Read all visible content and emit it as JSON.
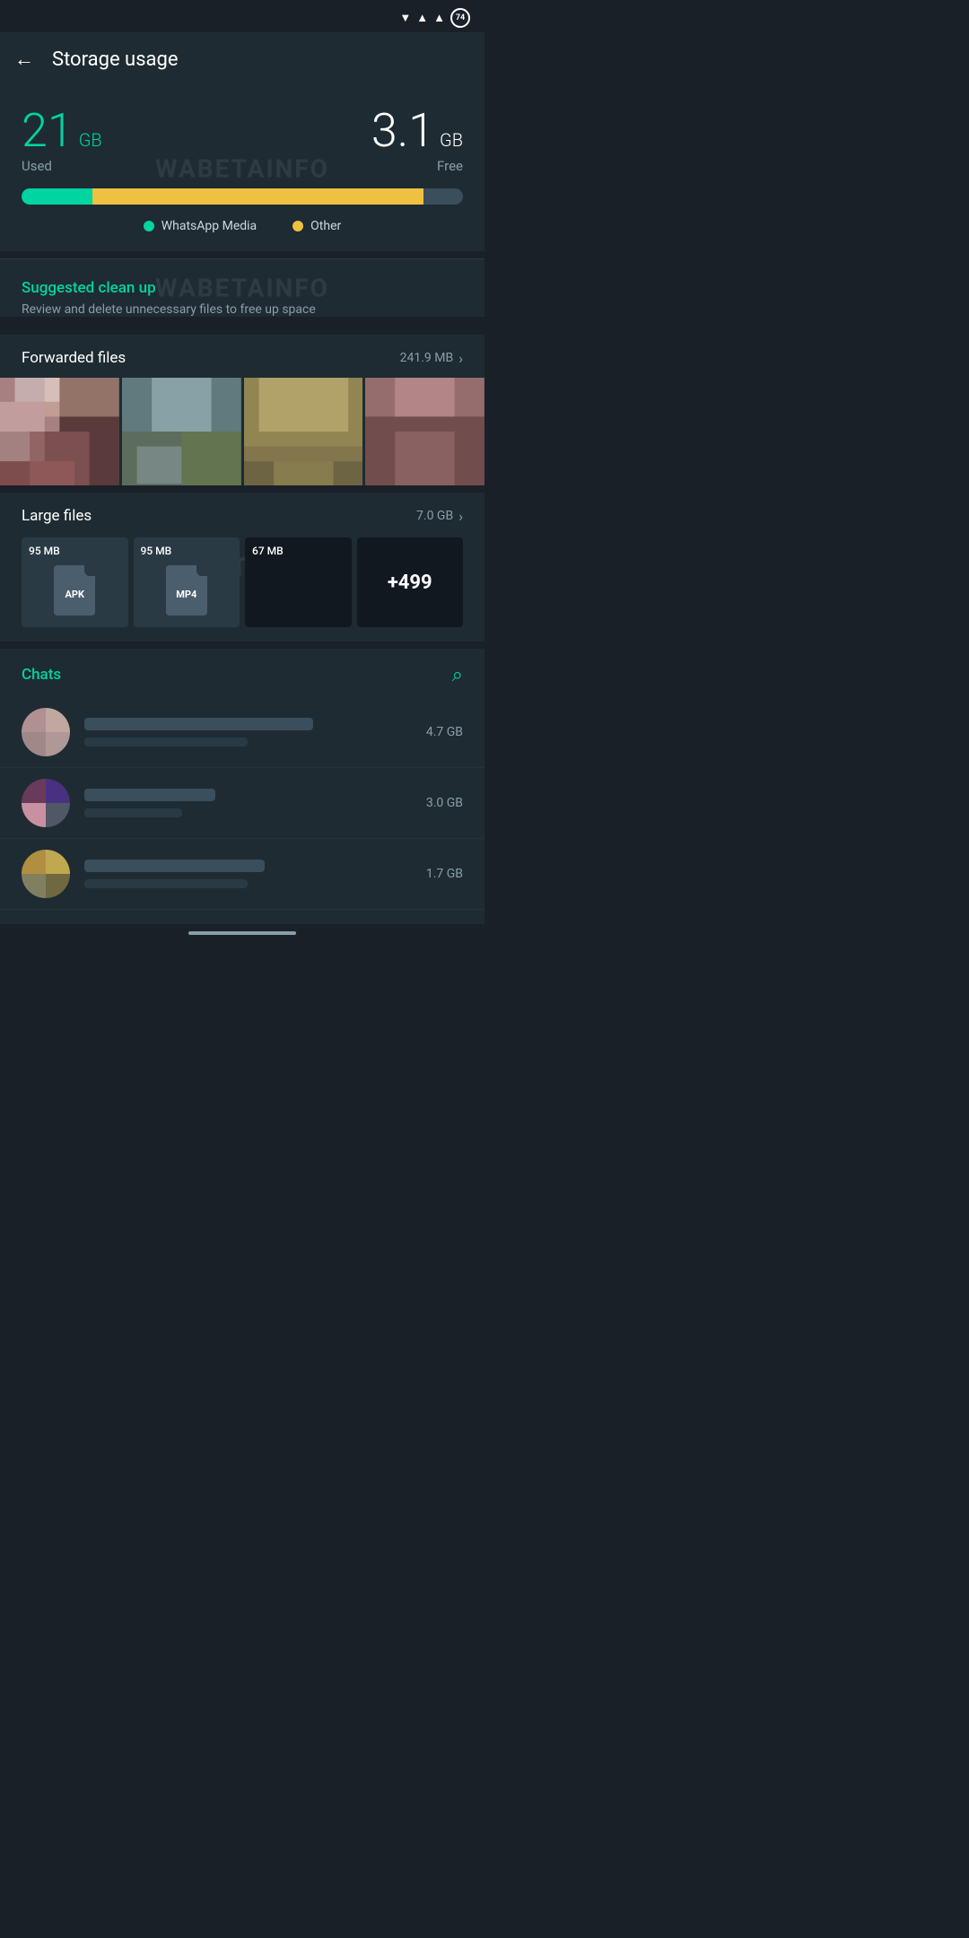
{
  "statusBar": {
    "battery": "74"
  },
  "toolbar": {
    "title": "Storage usage",
    "backLabel": "←"
  },
  "storage": {
    "usedNumber": "21",
    "usedUnit": "GB",
    "usedLabel": "Used",
    "freeNumber": "3.1",
    "freeUnit": "GB",
    "freeLabel": "Free",
    "barUsedPercent": 16,
    "barOtherPercent": 75,
    "legend": [
      {
        "label": "WhatsApp Media",
        "color": "teal"
      },
      {
        "label": "Other",
        "color": "yellow"
      }
    ]
  },
  "suggestedCleanup": {
    "title": "Suggested clean up",
    "description": "Review and delete unnecessary files to free up space"
  },
  "forwardedFiles": {
    "title": "Forwarded files",
    "size": "241.9 MB"
  },
  "largeFiles": {
    "title": "Large files",
    "size": "7.0 GB",
    "files": [
      {
        "size": "95 MB",
        "type": "APK"
      },
      {
        "size": "95 MB",
        "type": "MP4"
      },
      {
        "size": "67 MB",
        "type": ""
      },
      {
        "size": "",
        "type": "+499"
      }
    ]
  },
  "chats": {
    "title": "Chats",
    "items": [
      {
        "size": "4.7 GB"
      },
      {
        "size": "3.0 GB"
      },
      {
        "size": "1.7 GB"
      }
    ]
  },
  "watermark": "WABETAINFO"
}
